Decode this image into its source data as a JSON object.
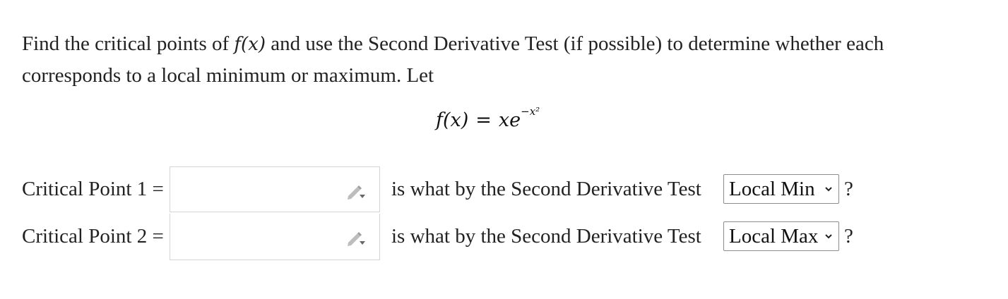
{
  "problem": {
    "text_part1": "Find the critical points of ",
    "fx_inline": "f(x)",
    "text_part2": " and use the Second Derivative Test (if possible) to determine whether each corresponds to a local minimum or maximum. Let"
  },
  "equation": {
    "lhs": "f(x)",
    "equals": "=",
    "base": "xe",
    "exponent": "−x²"
  },
  "rows": [
    {
      "label": "Critical Point 1 =",
      "input_value": "",
      "mid_text": "is what by the Second Derivative Test",
      "selected": "Local Min",
      "suffix": "?"
    },
    {
      "label": "Critical Point 2 =",
      "input_value": "",
      "mid_text": "is what by the Second Derivative Test",
      "selected": "Local Max",
      "suffix": "?"
    }
  ],
  "icons": {
    "answer_tool": "pencil-icon",
    "dropdown": "chevron-down-icon"
  },
  "colors": {
    "text": "#222222",
    "box_border": "#d4d4d4",
    "select_border": "#8c8c8c"
  }
}
